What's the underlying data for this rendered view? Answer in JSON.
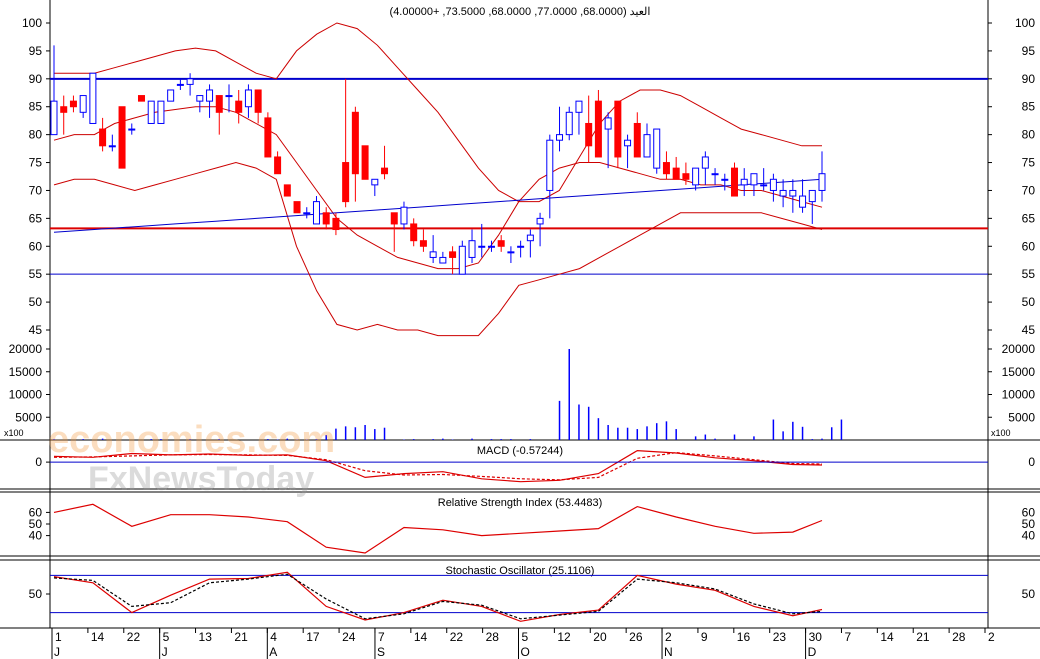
{
  "header_text": "العيد (68.0000, 77.0000, 68.0000, 73.5000, +4.00000)",
  "volume_multiplier_label": "x100",
  "watermark": {
    "line1": "economies.com",
    "line2": "FxNewsToday"
  },
  "colors": {
    "up": "#0000ff",
    "down": "#ff0000",
    "band": "#cc0000",
    "ma": "#0000cc",
    "volume": "#0000ff",
    "grid": "#000000",
    "axis_text": "#000000"
  },
  "chart_data": [
    {
      "type": "candlestick",
      "name": "price",
      "ylim": [
        42,
        102
      ],
      "y_ticks": [
        100,
        95,
        90,
        85,
        80,
        75,
        70,
        65,
        60,
        55,
        50,
        45
      ],
      "horizontal_lines": [
        {
          "value": 90,
          "color": "#0000cc",
          "width": 2
        },
        {
          "value": 63.2,
          "color": "#dd0000",
          "width": 2
        },
        {
          "value": 55,
          "color": "#0000cc",
          "width": 1
        }
      ],
      "x_labels": [
        "1",
        "14",
        "22",
        "5",
        "13",
        "21",
        "4",
        "17",
        "24",
        "7",
        "14",
        "22",
        "28",
        "5",
        "12",
        "20",
        "26",
        "2",
        "9",
        "16",
        "23",
        "30",
        "7",
        "14",
        "21",
        "28",
        "2"
      ],
      "month_labels": [
        "J",
        "J",
        "A",
        "S",
        "O",
        "N",
        "D"
      ],
      "ohlc": [
        [
          80,
          96,
          80,
          86
        ],
        [
          85,
          87,
          80,
          84
        ],
        [
          86,
          87,
          84,
          85
        ],
        [
          84,
          87,
          83,
          87
        ],
        [
          82,
          91,
          82,
          91
        ],
        [
          81,
          83,
          77,
          78
        ],
        [
          78,
          80,
          77,
          78
        ],
        [
          85,
          85,
          74,
          74
        ],
        [
          81,
          82,
          80,
          81
        ],
        [
          87,
          87,
          86,
          86
        ],
        [
          82,
          86,
          82,
          86
        ],
        [
          82,
          86,
          82,
          86
        ],
        [
          86,
          88,
          86,
          88
        ],
        [
          89,
          90,
          88,
          89
        ],
        [
          89,
          91,
          87,
          90
        ],
        [
          86,
          87,
          84,
          87
        ],
        [
          86,
          89,
          83,
          88
        ],
        [
          87,
          87,
          80,
          84
        ],
        [
          87,
          89,
          84,
          87
        ],
        [
          86,
          88,
          82,
          84
        ],
        [
          85,
          89,
          83,
          88
        ],
        [
          88,
          88,
          82,
          84
        ],
        [
          83,
          84,
          76,
          76
        ],
        [
          76,
          77,
          73,
          73
        ],
        [
          71,
          71,
          69,
          69
        ],
        [
          68,
          68,
          66,
          66
        ],
        [
          66,
          67,
          65,
          66
        ],
        [
          64,
          69,
          64,
          68
        ],
        [
          66,
          67,
          63,
          64
        ],
        [
          65,
          66,
          62,
          63
        ],
        [
          75,
          90,
          67,
          68
        ],
        [
          84,
          85,
          68,
          73
        ],
        [
          78,
          78,
          73,
          72
        ],
        [
          71,
          72,
          69,
          72
        ],
        [
          74,
          78,
          72,
          73
        ],
        [
          66,
          66,
          59,
          64
        ],
        [
          64,
          68,
          63,
          67
        ],
        [
          64,
          65,
          60,
          61
        ],
        [
          61,
          63,
          59,
          60
        ],
        [
          58,
          62,
          57,
          59
        ],
        [
          57,
          59,
          57,
          58
        ],
        [
          59,
          60,
          55,
          58
        ],
        [
          55,
          61,
          55,
          60
        ],
        [
          58,
          63,
          57,
          61
        ],
        [
          60,
          64,
          58,
          60
        ],
        [
          60,
          61,
          59,
          60
        ],
        [
          61,
          62,
          59,
          60
        ],
        [
          59,
          60,
          57,
          59
        ],
        [
          60,
          61,
          58,
          60
        ],
        [
          61,
          63,
          58,
          62
        ],
        [
          64,
          66,
          60,
          65
        ],
        [
          70,
          80,
          65,
          79
        ],
        [
          79,
          85,
          77,
          80
        ],
        [
          80,
          85,
          79,
          84
        ],
        [
          84,
          86,
          80,
          86
        ],
        [
          82,
          87,
          75,
          78
        ],
        [
          86,
          88,
          76,
          76
        ],
        [
          81,
          84,
          74,
          83
        ],
        [
          86,
          86,
          74,
          76
        ],
        [
          78,
          80,
          74,
          79
        ],
        [
          82,
          84,
          76,
          76
        ],
        [
          76,
          82,
          76,
          80
        ],
        [
          74,
          80,
          73,
          81
        ],
        [
          75,
          77,
          72,
          73
        ],
        [
          74,
          76,
          72,
          72
        ],
        [
          73,
          75,
          71,
          72
        ],
        [
          71,
          74,
          70,
          74
        ],
        [
          74,
          77,
          71,
          76
        ],
        [
          73,
          74,
          71,
          73
        ],
        [
          72,
          73,
          70,
          72
        ],
        [
          74,
          75,
          69,
          69
        ],
        [
          71,
          74,
          69,
          72
        ],
        [
          71,
          73,
          69,
          73
        ],
        [
          71,
          74,
          70,
          71
        ],
        [
          70,
          73,
          68,
          72
        ],
        [
          69,
          72,
          67,
          70
        ],
        [
          69,
          72,
          66,
          70
        ],
        [
          67,
          72,
          66,
          69
        ],
        [
          68,
          70,
          64,
          70
        ],
        [
          70,
          77,
          68,
          73
        ]
      ],
      "upper_band": [
        91,
        91,
        91,
        92,
        93,
        94,
        95,
        95.5,
        95,
        93,
        91,
        90,
        95,
        98,
        100,
        99,
        96,
        92,
        88,
        84,
        79,
        74,
        70,
        68,
        68,
        70,
        76,
        82,
        86,
        88,
        88,
        87,
        85,
        83,
        81,
        80,
        79,
        78,
        78
      ],
      "middle_band": [
        79,
        80,
        80,
        82,
        83,
        84,
        84.5,
        85,
        85,
        84,
        82,
        80,
        75,
        70,
        65,
        62,
        60,
        58,
        57,
        56,
        56,
        57,
        62,
        68,
        72,
        74,
        75,
        75,
        74,
        73,
        72,
        72,
        71,
        71,
        70,
        70,
        69,
        68,
        67
      ],
      "lower_band": [
        71,
        72,
        72,
        71,
        70,
        71,
        72,
        73,
        74,
        75,
        74,
        72,
        60,
        52,
        46,
        45,
        46,
        45,
        45,
        44,
        44,
        44,
        48,
        53,
        54,
        55,
        56,
        58,
        60,
        62,
        64,
        66,
        66,
        66,
        66,
        66,
        65,
        64,
        63
      ],
      "moving_average": [
        62.5,
        63,
        63.5,
        64,
        64.5,
        65,
        65.5,
        66,
        66.5,
        67,
        67.5,
        68,
        68.5,
        69,
        69.5,
        70,
        70.5,
        71,
        71.5,
        72
      ]
    },
    {
      "type": "bar",
      "name": "volume",
      "ylim": [
        0,
        22500
      ],
      "y_ticks": [
        20000,
        15000,
        10000,
        5000
      ],
      "values": [
        200,
        0,
        0,
        200,
        0,
        300,
        0,
        0,
        0,
        0,
        200,
        200,
        0,
        0,
        200,
        0,
        0,
        200,
        0,
        0,
        0,
        0,
        200,
        100,
        300,
        100,
        100,
        200,
        1100,
        2500,
        3000,
        2800,
        3300,
        2400,
        2700,
        0,
        100,
        200,
        0,
        200,
        300,
        100,
        0,
        300,
        0,
        200,
        200,
        200,
        0,
        200,
        0,
        0,
        8600,
        20000,
        7800,
        7300,
        4800,
        3300,
        2700,
        2700,
        2400,
        3000,
        3700,
        4100,
        2400,
        0,
        800,
        1200,
        300,
        0,
        1200,
        0,
        800,
        0,
        4500,
        1900,
        4000,
        2900,
        200,
        300,
        2800,
        4500
      ]
    },
    {
      "type": "line",
      "name": "MACD",
      "title": "MACD (-0.57244)",
      "ylim": [
        -5,
        4
      ],
      "y_ticks": [
        0
      ],
      "x": [
        0,
        4,
        8,
        12,
        16,
        20,
        24,
        28,
        32,
        36,
        40,
        44,
        48,
        52,
        56,
        60,
        64,
        68,
        72,
        76,
        79
      ],
      "macd": [
        1.2,
        1.0,
        1.8,
        1.5,
        1.7,
        1.4,
        1.5,
        0.3,
        -3.2,
        -2.4,
        -2.0,
        -3.5,
        -4.1,
        -3.8,
        -2.4,
        2.4,
        1.9,
        0.9,
        0.3,
        -0.5,
        -0.6
      ],
      "signal": [
        1.0,
        1.1,
        1.3,
        1.5,
        1.6,
        1.5,
        1.4,
        0.5,
        -1.8,
        -2.7,
        -2.6,
        -3.0,
        -3.5,
        -3.7,
        -3.2,
        0.8,
        2.0,
        1.3,
        0.5,
        -0.3,
        -0.4
      ]
    },
    {
      "type": "line",
      "name": "RSI",
      "title": "Relative Strength Index (53.4483)",
      "ylim": [
        25,
        75
      ],
      "y_ticks": [
        60,
        50,
        40
      ],
      "x": [
        0,
        4,
        8,
        12,
        16,
        20,
        24,
        28,
        32,
        36,
        40,
        44,
        48,
        52,
        56,
        60,
        64,
        68,
        72,
        76,
        79
      ],
      "values": [
        60,
        67,
        48,
        58,
        58,
        56,
        52,
        30,
        25,
        47,
        45,
        40,
        42,
        44,
        46,
        65,
        56,
        48,
        42,
        43,
        53
      ]
    },
    {
      "type": "line",
      "name": "Stochastic",
      "title": "Stochastic Oscillator (25.1106)",
      "ylim": [
        0,
        100
      ],
      "y_ticks": [
        50
      ],
      "horizontal_lines": [
        80,
        20
      ],
      "x": [
        0,
        4,
        8,
        12,
        16,
        20,
        24,
        28,
        32,
        36,
        40,
        44,
        48,
        52,
        56,
        60,
        64,
        68,
        72,
        76,
        79
      ],
      "k": [
        78,
        68,
        20,
        48,
        74,
        75,
        85,
        30,
        8,
        20,
        40,
        30,
        6,
        17,
        24,
        80,
        66,
        56,
        30,
        15,
        25
      ],
      "d": [
        76,
        72,
        30,
        36,
        68,
        74,
        82,
        42,
        10,
        18,
        38,
        32,
        10,
        16,
        22,
        74,
        68,
        58,
        34,
        18,
        22
      ]
    }
  ]
}
